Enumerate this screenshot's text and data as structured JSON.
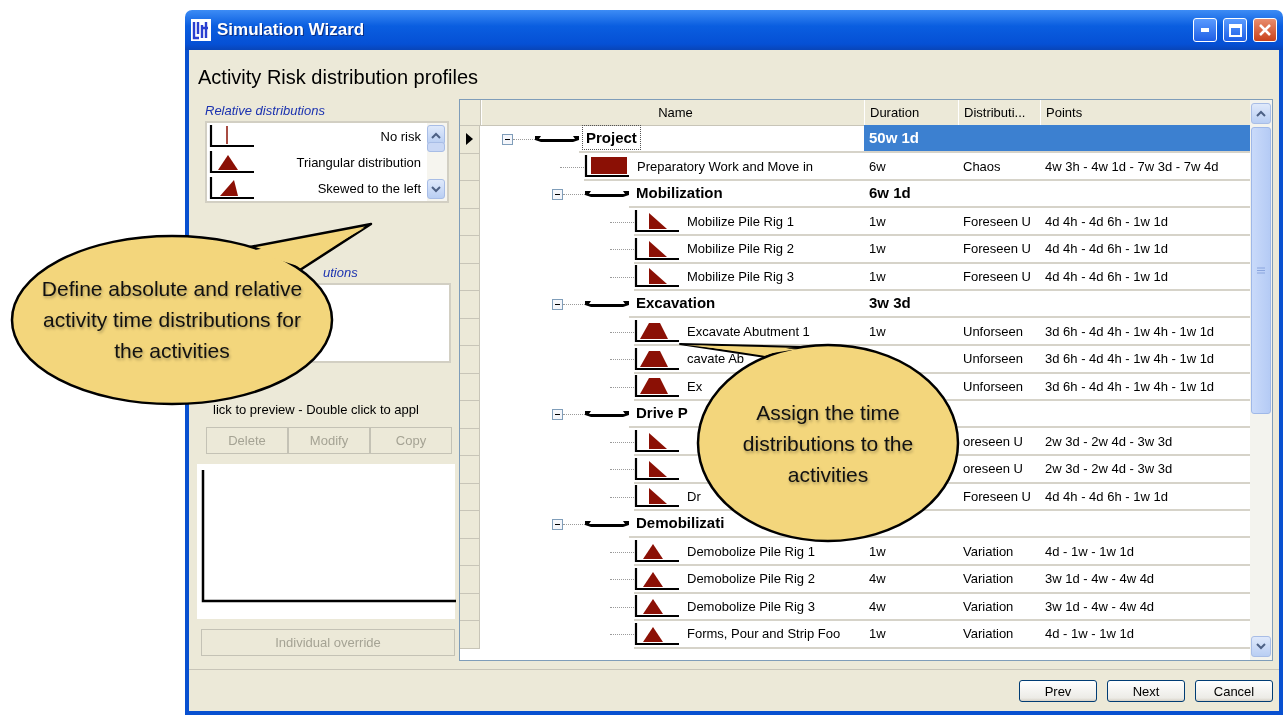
{
  "window": {
    "title": "Simulation Wizard"
  },
  "heading": "Activity Risk distribution profiles",
  "relative_distributions": {
    "label": "Relative distributions",
    "items": [
      {
        "label": "No risk",
        "profile": {
          "kind": "spike"
        }
      },
      {
        "label": "Triangular distribution",
        "profile": {
          "kind": "triangle"
        }
      },
      {
        "label": "Skewed to the left",
        "profile": {
          "kind": "skew-left"
        }
      }
    ]
  },
  "absolute_distributions": {
    "label": "utions"
  },
  "hint": "lick to preview - Double click to appl",
  "actions": [
    {
      "label": "Delete",
      "disabled": true
    },
    {
      "label": "Modify",
      "disabled": true
    },
    {
      "label": "Copy",
      "disabled": true
    }
  ],
  "override_button": {
    "label": "Individual override",
    "disabled": true
  },
  "grid": {
    "columns": [
      "Name",
      "Duration",
      "Distributi...",
      "Points"
    ],
    "rows": [
      {
        "kind": "summary",
        "name": "Project",
        "duration": "50w 1d",
        "selected": true,
        "expanded": true,
        "children": [
          {
            "kind": "task",
            "profile": {
              "kind": "block"
            },
            "name": "Preparatory Work and Move in",
            "duration": "6w",
            "distribution": "Chaos",
            "points": "4w 3h - 4w 1d - 7w 3d - 7w 4d",
            "selected": false
          },
          {
            "kind": "summary",
            "name": "Mobilization",
            "duration": "6w 1d",
            "selected": false,
            "expanded": true,
            "children": [
              {
                "kind": "task",
                "profile": {
                  "kind": "right-triangle"
                },
                "name": "Mobilize Pile Rig 1",
                "duration": "1w",
                "distribution": "Foreseen U",
                "points": "4d 4h - 4d 6h - 1w 1d",
                "selected": false
              },
              {
                "kind": "task",
                "profile": {
                  "kind": "right-triangle"
                },
                "name": "Mobilize Pile Rig 2",
                "duration": "1w",
                "distribution": "Foreseen U",
                "points": "4d 4h - 4d 6h - 1w 1d",
                "selected": false
              },
              {
                "kind": "task",
                "profile": {
                  "kind": "right-triangle"
                },
                "name": "Mobilize Pile Rig 3",
                "duration": "1w",
                "distribution": "Foreseen U",
                "points": "4d 4h - 4d 6h - 1w 1d",
                "selected": false
              }
            ]
          },
          {
            "kind": "summary",
            "name": "Excavation",
            "duration": "3w 3d",
            "selected": false,
            "expanded": true,
            "children": [
              {
                "kind": "task",
                "profile": {
                  "kind": "trapezoid"
                },
                "name": "Excavate Abutment 1",
                "duration": "1w",
                "distribution": "Unforseen",
                "points": "3d 6h - 4d 4h - 1w 4h - 1w 1d",
                "selected": false
              },
              {
                "kind": "task",
                "profile": {
                  "kind": "trapezoid"
                },
                "name": "cavate Ab",
                "distribution": "Unforseen",
                "points": "3d 6h - 4d 4h - 1w 4h - 1w 1d",
                "selected": false
              },
              {
                "kind": "task",
                "profile": {
                  "kind": "trapezoid"
                },
                "name": "Ex",
                "distribution": "Unforseen",
                "points": "3d 6h - 4d 4h - 1w 4h - 1w 1d",
                "selected": false
              }
            ]
          },
          {
            "kind": "summary",
            "name": "Drive P",
            "selected": false,
            "expanded": true,
            "children": [
              {
                "kind": "task",
                "profile": {
                  "kind": "right-triangle"
                },
                "distribution": "oreseen U",
                "points": "2w 3d - 2w 4d - 3w 3d",
                "selected": false
              },
              {
                "kind": "task",
                "profile": {
                  "kind": "right-triangle"
                },
                "distribution": "oreseen U",
                "points": "2w 3d - 2w 4d - 3w 3d",
                "selected": false
              },
              {
                "kind": "task",
                "profile": {
                  "kind": "right-triangle"
                },
                "name": "Dr",
                "distribution": "Foreseen U",
                "points": "4d 4h - 4d 6h - 1w 1d",
                "selected": false
              }
            ]
          },
          {
            "kind": "summary",
            "name": "Demobilizati",
            "selected": false,
            "expanded": true,
            "children": [
              {
                "kind": "task",
                "profile": {
                  "kind": "triangle"
                },
                "name": "Demobolize Pile Rig 1",
                "duration": "1w",
                "distribution": "Variation",
                "points": "4d - 1w - 1w 1d",
                "selected": false
              },
              {
                "kind": "task",
                "profile": {
                  "kind": "triangle"
                },
                "name": "Demobolize Pile Rig 2",
                "duration": "4w",
                "distribution": "Variation",
                "points": "3w 1d - 4w - 4w 4d",
                "selected": false
              },
              {
                "kind": "task",
                "profile": {
                  "kind": "triangle"
                },
                "name": "Demobolize Pile Rig 3",
                "duration": "4w",
                "distribution": "Variation",
                "points": "3w 1d - 4w - 4w 4d",
                "selected": false
              },
              {
                "kind": "task",
                "profile": {
                  "kind": "triangle"
                },
                "name": "Forms, Pour and Strip Foo",
                "duration": "1w",
                "distribution": "Variation",
                "points": "4d - 1w - 1w 1d",
                "selected": false
              }
            ]
          }
        ]
      }
    ]
  },
  "footer_buttons": [
    "Prev",
    "Next",
    "Cancel"
  ],
  "callouts": [
    {
      "text": "Define absolute and relative activity time distributions for the activities"
    },
    {
      "text": "Assign the time distributions to the activities"
    }
  ]
}
